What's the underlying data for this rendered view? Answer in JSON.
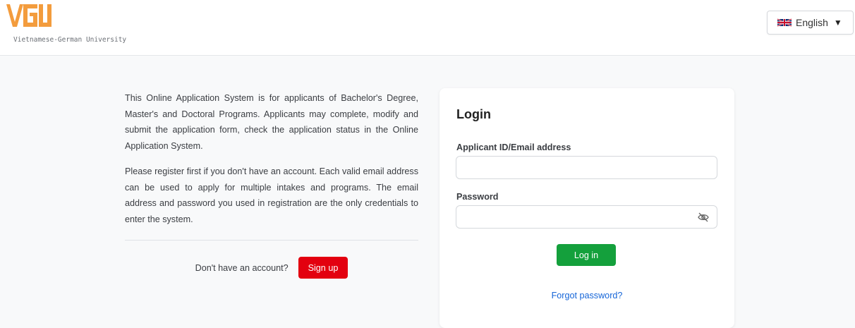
{
  "header": {
    "logo_subtitle": "Vietnamese-German University",
    "logo_text": "VGU",
    "brand_color": "#f39c3d",
    "language": {
      "label": "English",
      "flag_icon": "uk-flag-icon",
      "caret_icon": "caret-down-icon"
    }
  },
  "intro": {
    "paragraph_1": "This Online Application System is for applicants of Bachelor's Degree, Master's and Doctoral Programs. Applicants may complete, modify and submit the application form, check the application status in the Online Application System.",
    "paragraph_2": "Please register first if you don't have an account. Each valid email address can be used to apply for multiple intakes and programs. The email address and password you used in registration are the only credentials to enter the system.",
    "no_account_text": "Don't have an account?",
    "signup_label": "Sign up",
    "signup_color": "#e3000f"
  },
  "login": {
    "title": "Login",
    "id_label": "Applicant ID/Email address",
    "id_value": "",
    "password_label": "Password",
    "password_value": "",
    "toggle_icon": "eye-slash-icon",
    "login_label": "Log in",
    "login_color": "#14a03c",
    "forgot_label": "Forgot password?"
  }
}
